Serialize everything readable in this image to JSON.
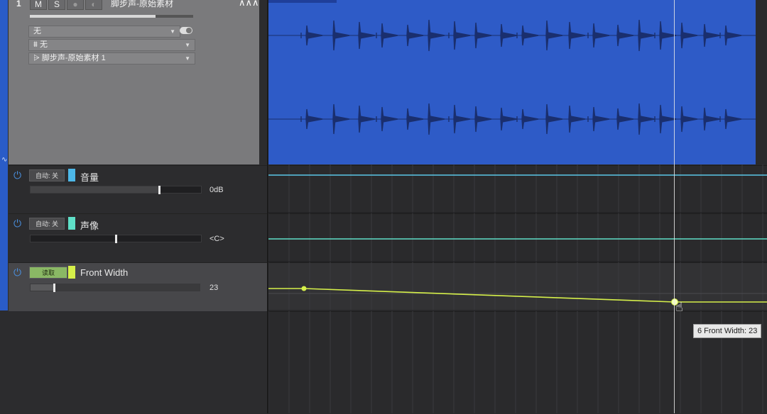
{
  "track": {
    "number": "1",
    "mute_label": "M",
    "solo_label": "S",
    "record_label": "●",
    "monitor_label": "◐",
    "name": "脚步声-原始素材",
    "volume_level": 0.77,
    "input_select": "无",
    "output_select": "无",
    "layer_select": "脚步声-原始素材 1"
  },
  "automation_lanes": [
    {
      "mode": "自动: 关",
      "color": "#4db8e8",
      "name": "音量",
      "value": "0dB",
      "level": 0.75
    },
    {
      "mode": "自动: 关",
      "color": "#5fe0c8",
      "name": "声像",
      "value": "<C>",
      "level": 0.5
    },
    {
      "mode": "读取",
      "color": "#d6f04a",
      "name": "Front Width",
      "value": "23",
      "level": 0.14
    }
  ],
  "tooltip": {
    "text": "6  Front Width: 23"
  },
  "colors": {
    "clip": "#2e5bc7",
    "waveform": "#1a2f6e",
    "volume_line": "#5ac8e8",
    "pan_line": "#5fe0c8",
    "width_line": "#d6f04a"
  }
}
